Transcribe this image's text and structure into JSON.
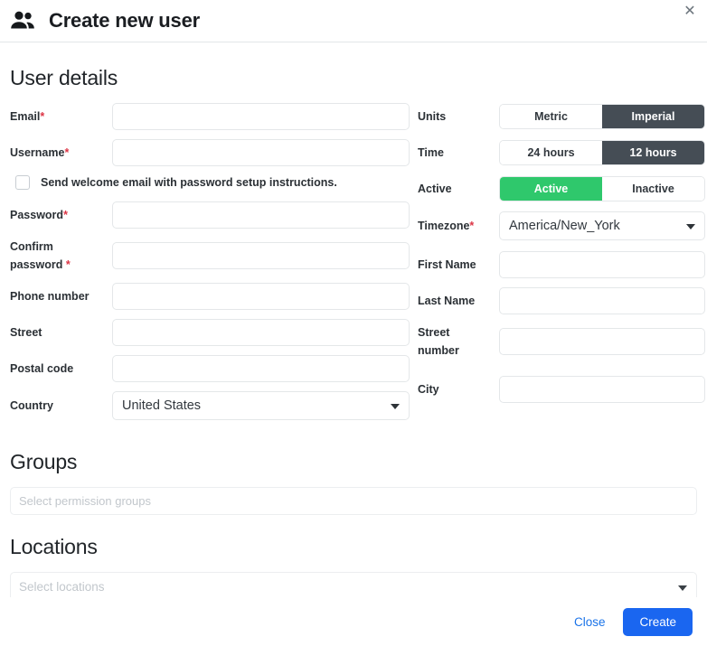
{
  "header": {
    "title": "Create new user",
    "icon": "people-icon",
    "close_label": "✕"
  },
  "sections": {
    "user_details": "User details",
    "groups": "Groups",
    "locations": "Locations"
  },
  "left_fields": [
    {
      "label": "Email",
      "required": true,
      "value": "",
      "placeholder": "",
      "type": "input",
      "name": "email"
    },
    {
      "label": "Username",
      "required": true,
      "value": "",
      "placeholder": "",
      "type": "input",
      "name": "username"
    },
    {
      "label": "Password",
      "required": true,
      "value": "",
      "placeholder": "",
      "type": "input",
      "name": "password"
    },
    {
      "label": "Confirm password ",
      "required": true,
      "value": "",
      "placeholder": "",
      "type": "input",
      "name": "confirm-password"
    },
    {
      "label": "Phone number",
      "required": false,
      "value": "",
      "placeholder": "",
      "type": "input",
      "name": "phone-number"
    },
    {
      "label": "Street",
      "required": false,
      "value": "",
      "placeholder": "",
      "type": "input",
      "name": "street"
    },
    {
      "label": "Postal code",
      "required": false,
      "value": "",
      "placeholder": "",
      "type": "input",
      "name": "postal-code"
    },
    {
      "label": "Country",
      "required": false,
      "value": "United States",
      "type": "select",
      "name": "country"
    }
  ],
  "checkbox": {
    "label": "Send welcome email with password setup instructions.",
    "checked": false
  },
  "right_fields": {
    "units": {
      "label": "Units",
      "options": [
        "Metric",
        "Imperial"
      ],
      "selected": "Imperial"
    },
    "time": {
      "label": "Time",
      "options": [
        "24 hours",
        "12 hours"
      ],
      "selected": "12 hours"
    },
    "active": {
      "label": "Active",
      "options": [
        "Active",
        "Inactive"
      ],
      "selected": "Active"
    },
    "timezone": {
      "label": "Timezone",
      "required": true,
      "value": "America/New_York"
    },
    "first_name": {
      "label": "First Name",
      "value": "",
      "placeholder": ""
    },
    "last_name": {
      "label": "Last Name",
      "value": "",
      "placeholder": ""
    },
    "street_number": {
      "label": "Street number",
      "value": "",
      "placeholder": ""
    },
    "city": {
      "label": "City",
      "value": "",
      "placeholder": ""
    }
  },
  "groups_select": {
    "placeholder": "Select permission groups",
    "value": ""
  },
  "locations_select": {
    "placeholder": "Select locations",
    "value": ""
  },
  "footer": {
    "close_label": "Close",
    "create_label": "Create"
  },
  "colors": {
    "primary": "#1a66f0",
    "link": "#1a73e8",
    "toggle_selected_dark": "#454d55",
    "toggle_selected_green": "#2fc86c",
    "required_asterisk": "#dc3545",
    "border": "#e4e7e9"
  }
}
